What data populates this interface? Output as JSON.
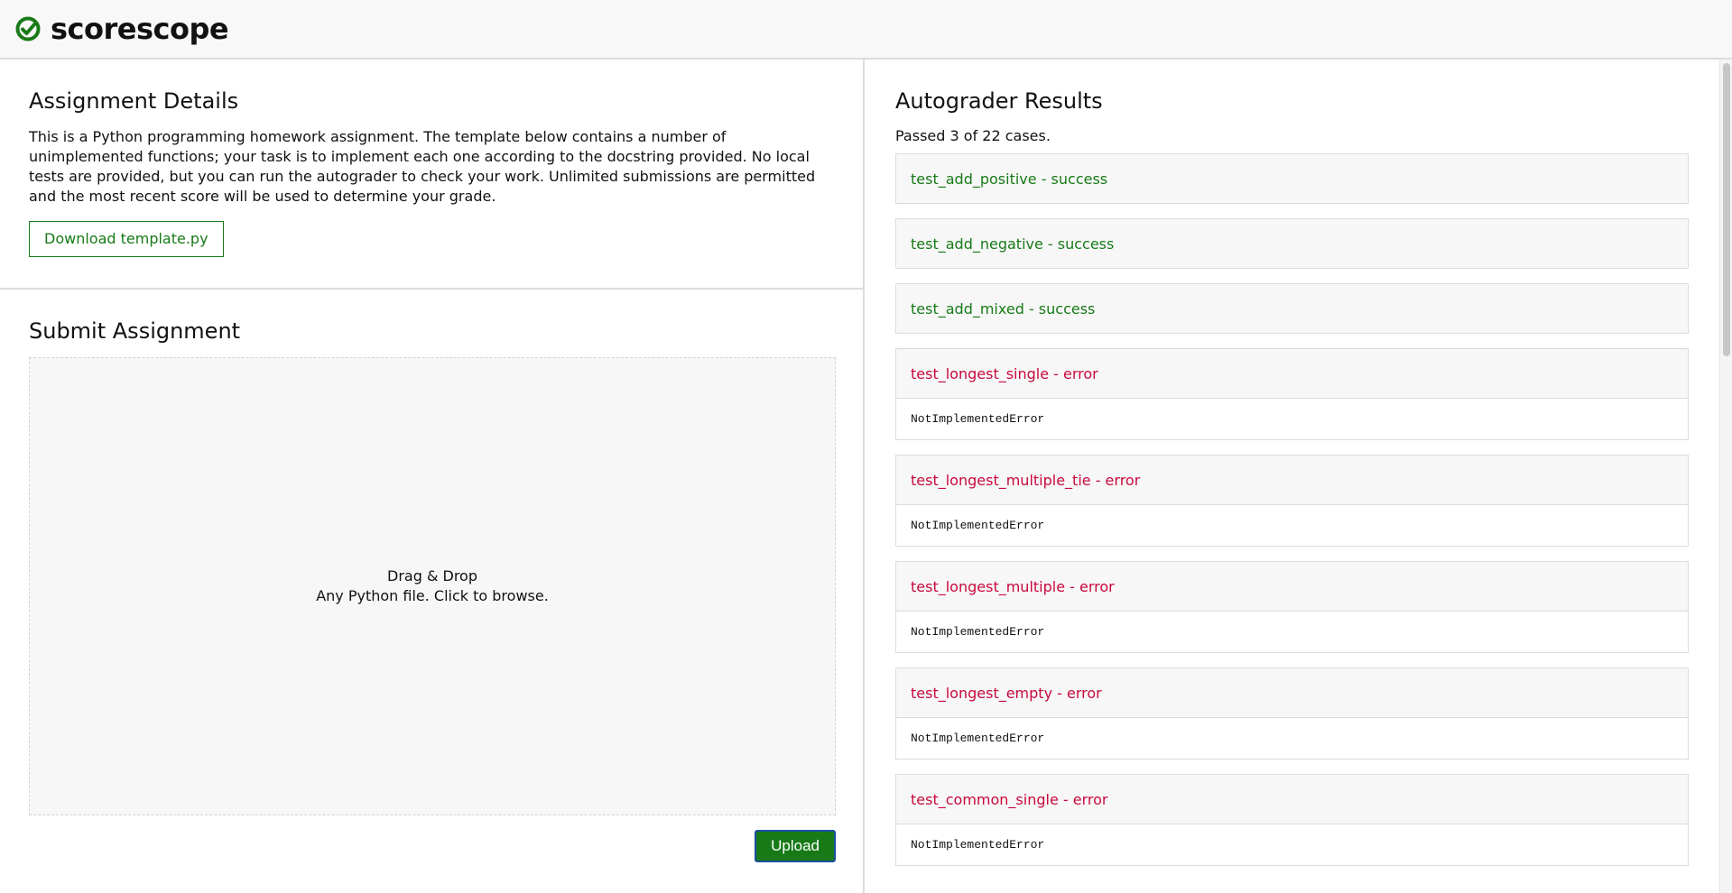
{
  "app": {
    "name": "scorescope",
    "logo_icon": "check-circle-icon",
    "brand_color": "#177a17"
  },
  "details": {
    "title": "Assignment Details",
    "description": "This is a Python programming homework assignment. The template below contains a number of unimplemented functions; your task is to implement each one according to the docstring provided. No local tests are provided, but you can run the autograder to check your work. Unlimited submissions are permitted and the most recent score will be used to determine your grade.",
    "download_label": "Download template.py"
  },
  "submit": {
    "title": "Submit Assignment",
    "dropzone_line1": "Drag & Drop",
    "dropzone_line2": "Any Python file. Click to browse.",
    "upload_label": "Upload"
  },
  "results": {
    "title": "Autograder Results",
    "summary": "Passed 3 of 22 cases.",
    "success_color": "#177a17",
    "error_color": "#c8093d",
    "cases": [
      {
        "label": "test_add_positive - success",
        "status": "success",
        "detail": ""
      },
      {
        "label": "test_add_negative - success",
        "status": "success",
        "detail": ""
      },
      {
        "label": "test_add_mixed - success",
        "status": "success",
        "detail": ""
      },
      {
        "label": "test_longest_single - error",
        "status": "error",
        "detail": "NotImplementedError"
      },
      {
        "label": "test_longest_multiple_tie - error",
        "status": "error",
        "detail": "NotImplementedError"
      },
      {
        "label": "test_longest_multiple - error",
        "status": "error",
        "detail": "NotImplementedError"
      },
      {
        "label": "test_longest_empty - error",
        "status": "error",
        "detail": "NotImplementedError"
      },
      {
        "label": "test_common_single - error",
        "status": "error",
        "detail": "NotImplementedError"
      }
    ]
  }
}
